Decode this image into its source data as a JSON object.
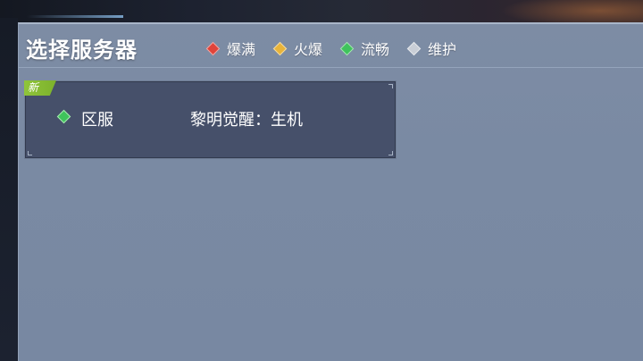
{
  "panel": {
    "title": "选择服务器"
  },
  "legend": [
    {
      "label": "爆满",
      "color": "#e0443a",
      "icon": "red-diamond-icon"
    },
    {
      "label": "火爆",
      "color": "#e8b43a",
      "icon": "yellow-diamond-icon"
    },
    {
      "label": "流畅",
      "color": "#3fc35c",
      "icon": "green-diamond-icon"
    },
    {
      "label": "维护",
      "color": "#c9ced6",
      "icon": "gray-diamond-icon"
    }
  ],
  "servers": [
    {
      "tag": "新",
      "zone": "区服",
      "name": "黎明觉醒：生机",
      "status_color": "#3fc35c"
    }
  ]
}
